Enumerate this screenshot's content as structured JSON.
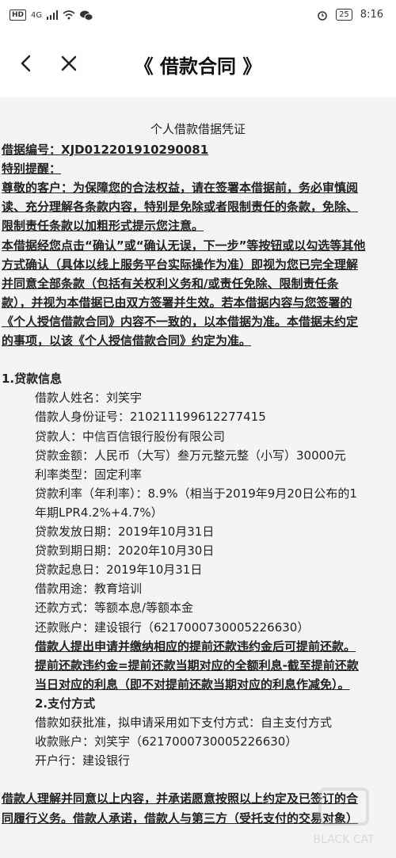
{
  "status": {
    "hd": "HD",
    "net": "4G",
    "battery": "25",
    "time": "8:16"
  },
  "nav": {
    "title": "《 借款合同 》"
  },
  "doc": {
    "title": "个人借款借据凭证",
    "lines": [
      {
        "t": "借据编号：XJD012201910290081",
        "s": "b"
      },
      {
        "t": "特别提醒：",
        "s": "b"
      },
      {
        "t": "尊敬的客户：为保障您的合法权益，请在签署本借据前，务必审慎阅",
        "s": "b"
      },
      {
        "t": "读、充分理解各条款内容，特别是免除或者限制责任的条款，免除、",
        "s": "b"
      },
      {
        "t": "限制责任条款以加粗形式提示您注意。",
        "s": "b"
      },
      {
        "t": "本借据经您点击“确认”或“确认无误，下一步”等按钮或以勾选等其他",
        "s": "b"
      },
      {
        "t": "方式确认（具体以线上服务平台实际操作为准）即视为您已完全理解",
        "s": "b"
      },
      {
        "t": "并同意全部条款（包括有关权利义务和/或责任免除、限制责任条",
        "s": "b"
      },
      {
        "t": "款），并视为本借据已由双方签署并生效。若本借据内容与您签署的",
        "s": "b"
      },
      {
        "t": "《个人授信借款合同》内容不一致的，以本借据为准。本借据未约定",
        "s": "b"
      },
      {
        "t": "的事项，以该《个人授信借款合同》约定为准。",
        "s": "b"
      },
      {
        "t": "",
        "s": "n"
      },
      {
        "t": "1.贷款信息",
        "s": "sec"
      },
      {
        "t": "借款人姓名：刘笑宇",
        "s": "ind"
      },
      {
        "t": "借款人身份证号：210211199612277415",
        "s": "ind"
      },
      {
        "t": "贷款人：中信百信银行股份有限公司",
        "s": "ind"
      },
      {
        "t": "贷款金额：人民币（大写）叁万元整元整（小写）30000元",
        "s": "ind"
      },
      {
        "t": "利率类型：固定利率",
        "s": "ind"
      },
      {
        "t": "贷款利率（年利率）：8.9%（相当于2019年9月20日公布的1",
        "s": "ind"
      },
      {
        "t": "年期LPR4.2%+4.7%）",
        "s": "ind"
      },
      {
        "t": "贷款发放日期：2019年10月31日",
        "s": "ind"
      },
      {
        "t": "贷款到期日期：2020年10月30日",
        "s": "ind"
      },
      {
        "t": "贷款起息日：2019年10月31日",
        "s": "ind"
      },
      {
        "t": "借款用途：教育培训",
        "s": "ind"
      },
      {
        "t": "还款方式：等额本息/等额本金",
        "s": "ind"
      },
      {
        "t": "还款账户：建设银行（6217000730005226630）",
        "s": "ind"
      },
      {
        "t": "借款人提出申请并缴纳相应的提前还款违约金后可提前还款。",
        "s": "indb"
      },
      {
        "t": "提前还款违约金=提前还款当期对应的全额利息-截至提前还款",
        "s": "indb"
      },
      {
        "t": "当日对应的利息（即不对提前还款当期对应的利息作减免）。",
        "s": "indb"
      },
      {
        "t": "2.支付方式",
        "s": "indsec"
      },
      {
        "t": "借款如获批准，拟申请采用如下支付方式：自主支付方式",
        "s": "ind"
      },
      {
        "t": "收款账户：刘笑宇（6217000730005226630）",
        "s": "ind"
      },
      {
        "t": "开户行：建设银行",
        "s": "ind"
      },
      {
        "t": "",
        "s": "n"
      },
      {
        "t": "借款人理解并同意以上内容，并承诺愿意按照以上约定及已签订的合",
        "s": "b"
      },
      {
        "t": "同履行义务。借款人承诺，借款人与第三方（受托支付的交易对象）",
        "s": "b"
      }
    ]
  },
  "watermark": {
    "text": "BLACK CAT"
  }
}
